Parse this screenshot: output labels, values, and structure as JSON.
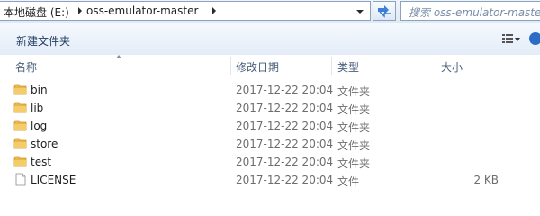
{
  "address_bar": {
    "crumbs": [
      "本地磁盘 (E:)",
      "oss-emulator-master"
    ]
  },
  "search": {
    "placeholder": "搜索 oss-emulator-master"
  },
  "toolbar": {
    "new_folder_label": "新建文件夹"
  },
  "columns": {
    "name": "名称",
    "date_modified": "修改日期",
    "type": "类型",
    "size": "大小"
  },
  "files": [
    {
      "name": "bin",
      "date": "2017-12-22 20:04",
      "type": "文件夹",
      "size": "",
      "icon": "folder-icon"
    },
    {
      "name": "lib",
      "date": "2017-12-22 20:04",
      "type": "文件夹",
      "size": "",
      "icon": "folder-icon"
    },
    {
      "name": "log",
      "date": "2017-12-22 20:04",
      "type": "文件夹",
      "size": "",
      "icon": "folder-icon"
    },
    {
      "name": "store",
      "date": "2017-12-22 20:04",
      "type": "文件夹",
      "size": "",
      "icon": "folder-icon"
    },
    {
      "name": "test",
      "date": "2017-12-22 20:04",
      "type": "文件夹",
      "size": "",
      "icon": "folder-icon"
    },
    {
      "name": "LICENSE",
      "date": "2017-12-22 20:04",
      "type": "文件",
      "size": "2 KB",
      "icon": "file-icon"
    }
  ],
  "colors": {
    "folder": "#e8b64a",
    "accent": "#2d6cc6"
  }
}
